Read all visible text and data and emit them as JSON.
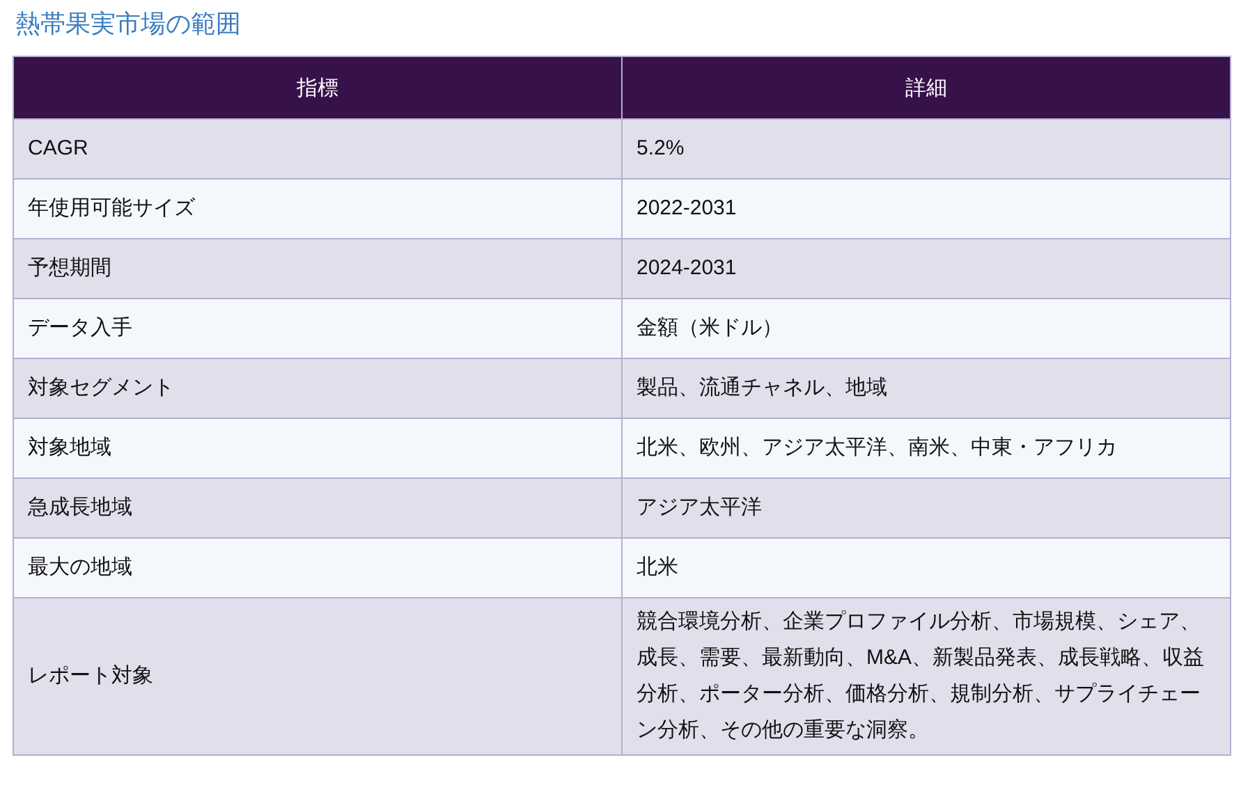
{
  "title": "熱帯果実市場の範囲",
  "table": {
    "columns": [
      "指標",
      "詳細"
    ],
    "rows": [
      [
        "CAGR",
        "5.2%"
      ],
      [
        "年使用可能サイズ",
        "2022-2031"
      ],
      [
        "予想期間",
        "2024-2031"
      ],
      [
        "データ入手",
        "金額（米ドル）"
      ],
      [
        "対象セグメント",
        "製品、流通チャネル、地域"
      ],
      [
        "対象地域",
        "北米、欧州、アジア太平洋、南米、中東・アフリカ"
      ],
      [
        "急成長地域",
        "アジア太平洋"
      ],
      [
        "最大の地域",
        "北米"
      ],
      [
        "レポート対象",
        "競合環境分析、企業プロファイル分析、市場規模、シェア、成長、需要、最新動向、M&A、新製品発表、成長戦略、収益分析、ポーター分析、価格分析、規制分析、サプライチェーン分析、その他の重要な洞察。"
      ]
    ]
  }
}
